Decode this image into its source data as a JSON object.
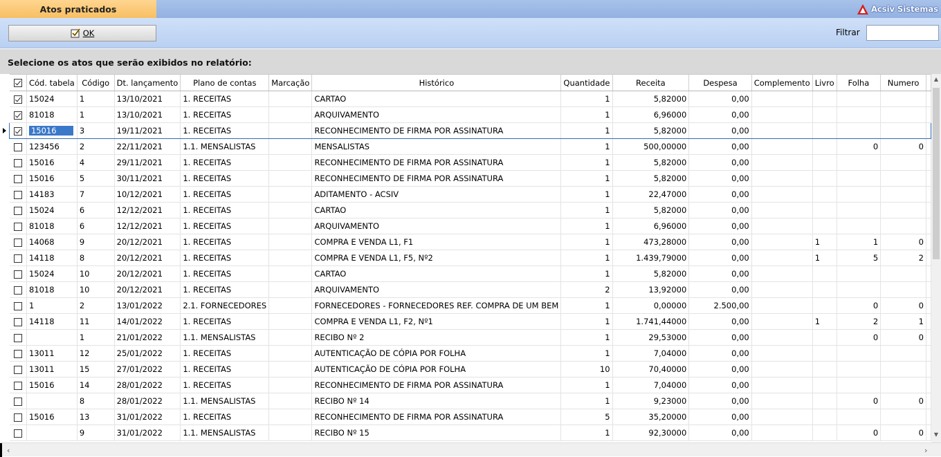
{
  "window": {
    "title": "Atos praticados",
    "brand": "Acsiv Sistemas"
  },
  "toolbar": {
    "ok_label": "OK",
    "filter_label": "Filtrar",
    "filter_value": ""
  },
  "instruction": "Selecione os atos que serão exibidos no relatório:",
  "grid": {
    "columns": [
      "Cód. tabela",
      "Código",
      "Dt. lançamento",
      "Plano de contas",
      "Marcação",
      "Histórico",
      "Quantidade",
      "Receita",
      "Despesa",
      "Complemento",
      "Livro",
      "Folha",
      "Numero"
    ],
    "current_row": 2,
    "rows": [
      {
        "checked": true,
        "cod_tabela": "15024",
        "codigo": "1",
        "dt": "13/10/2021",
        "plano": "1. RECEITAS",
        "marcacao": "",
        "historico": "CARTAO",
        "qtd": "1",
        "receita": "5,82000",
        "despesa": "0,00",
        "complemento": "",
        "livro": "",
        "folha": "",
        "numero": ""
      },
      {
        "checked": true,
        "cod_tabela": "81018",
        "codigo": "1",
        "dt": "13/10/2021",
        "plano": "1. RECEITAS",
        "marcacao": "",
        "historico": "ARQUIVAMENTO",
        "qtd": "1",
        "receita": "6,96000",
        "despesa": "0,00",
        "complemento": "",
        "livro": "",
        "folha": "",
        "numero": ""
      },
      {
        "checked": true,
        "cod_tabela": "15016",
        "codigo": "3",
        "dt": "19/11/2021",
        "plano": "1. RECEITAS",
        "marcacao": "",
        "historico": "RECONHECIMENTO DE FIRMA POR ASSINATURA",
        "qtd": "1",
        "receita": "5,82000",
        "despesa": "0,00",
        "complemento": "",
        "livro": "",
        "folha": "",
        "numero": ""
      },
      {
        "checked": false,
        "cod_tabela": "123456",
        "codigo": "2",
        "dt": "22/11/2021",
        "plano": "1.1. MENSALISTAS",
        "marcacao": "",
        "historico": "MENSALISTAS",
        "qtd": "1",
        "receita": "500,00000",
        "despesa": "0,00",
        "complemento": "",
        "livro": "",
        "folha": "0",
        "numero": "0"
      },
      {
        "checked": false,
        "cod_tabela": "15016",
        "codigo": "4",
        "dt": "29/11/2021",
        "plano": "1. RECEITAS",
        "marcacao": "",
        "historico": "RECONHECIMENTO DE FIRMA POR ASSINATURA",
        "qtd": "1",
        "receita": "5,82000",
        "despesa": "0,00",
        "complemento": "",
        "livro": "",
        "folha": "",
        "numero": ""
      },
      {
        "checked": false,
        "cod_tabela": "15016",
        "codigo": "5",
        "dt": "30/11/2021",
        "plano": "1. RECEITAS",
        "marcacao": "",
        "historico": "RECONHECIMENTO DE FIRMA POR ASSINATURA",
        "qtd": "1",
        "receita": "5,82000",
        "despesa": "0,00",
        "complemento": "",
        "livro": "",
        "folha": "",
        "numero": ""
      },
      {
        "checked": false,
        "cod_tabela": "14183",
        "codigo": "7",
        "dt": "10/12/2021",
        "plano": "1. RECEITAS",
        "marcacao": "",
        "historico": "ADITAMENTO - ACSIV",
        "qtd": "1",
        "receita": "22,47000",
        "despesa": "0,00",
        "complemento": "",
        "livro": "",
        "folha": "",
        "numero": ""
      },
      {
        "checked": false,
        "cod_tabela": "15024",
        "codigo": "6",
        "dt": "12/12/2021",
        "plano": "1. RECEITAS",
        "marcacao": "",
        "historico": "CARTAO",
        "qtd": "1",
        "receita": "5,82000",
        "despesa": "0,00",
        "complemento": "",
        "livro": "",
        "folha": "",
        "numero": ""
      },
      {
        "checked": false,
        "cod_tabela": "81018",
        "codigo": "6",
        "dt": "12/12/2021",
        "plano": "1. RECEITAS",
        "marcacao": "",
        "historico": "ARQUIVAMENTO",
        "qtd": "1",
        "receita": "6,96000",
        "despesa": "0,00",
        "complemento": "",
        "livro": "",
        "folha": "",
        "numero": ""
      },
      {
        "checked": false,
        "cod_tabela": "14068",
        "codigo": "9",
        "dt": "20/12/2021",
        "plano": "1. RECEITAS",
        "marcacao": "",
        "historico": "COMPRA E VENDA L1, F1",
        "qtd": "1",
        "receita": "473,28000",
        "despesa": "0,00",
        "complemento": "",
        "livro": "1",
        "folha": "1",
        "numero": "0"
      },
      {
        "checked": false,
        "cod_tabela": "14118",
        "codigo": "8",
        "dt": "20/12/2021",
        "plano": "1. RECEITAS",
        "marcacao": "",
        "historico": "COMPRA E VENDA L1, F5, Nº2",
        "qtd": "1",
        "receita": "1.439,79000",
        "despesa": "0,00",
        "complemento": "",
        "livro": "1",
        "folha": "5",
        "numero": "2"
      },
      {
        "checked": false,
        "cod_tabela": "15024",
        "codigo": "10",
        "dt": "20/12/2021",
        "plano": "1. RECEITAS",
        "marcacao": "",
        "historico": "CARTAO",
        "qtd": "1",
        "receita": "5,82000",
        "despesa": "0,00",
        "complemento": "",
        "livro": "",
        "folha": "",
        "numero": ""
      },
      {
        "checked": false,
        "cod_tabela": "81018",
        "codigo": "10",
        "dt": "20/12/2021",
        "plano": "1. RECEITAS",
        "marcacao": "",
        "historico": "ARQUIVAMENTO",
        "qtd": "2",
        "receita": "13,92000",
        "despesa": "0,00",
        "complemento": "",
        "livro": "",
        "folha": "",
        "numero": ""
      },
      {
        "checked": false,
        "cod_tabela": "1",
        "codigo": "2",
        "dt": "13/01/2022",
        "plano": "2.1. FORNECEDORES",
        "marcacao": "",
        "historico": "FORNECEDORES - FORNECEDORES REF. COMPRA DE UM BEM",
        "qtd": "1",
        "receita": "0,00000",
        "despesa": "2.500,00",
        "complemento": "",
        "livro": "",
        "folha": "0",
        "numero": "0"
      },
      {
        "checked": false,
        "cod_tabela": "14118",
        "codigo": "11",
        "dt": "14/01/2022",
        "plano": "1. RECEITAS",
        "marcacao": "",
        "historico": "COMPRA E VENDA L1, F2, Nº1",
        "qtd": "1",
        "receita": "1.741,44000",
        "despesa": "0,00",
        "complemento": "",
        "livro": "1",
        "folha": "2",
        "numero": "1"
      },
      {
        "checked": false,
        "cod_tabela": "",
        "codigo": "1",
        "dt": "21/01/2022",
        "plano": "1.1. MENSALISTAS",
        "marcacao": "",
        "historico": "RECIBO Nº 2",
        "qtd": "1",
        "receita": "29,53000",
        "despesa": "0,00",
        "complemento": "",
        "livro": "",
        "folha": "0",
        "numero": "0"
      },
      {
        "checked": false,
        "cod_tabela": "13011",
        "codigo": "12",
        "dt": "25/01/2022",
        "plano": "1. RECEITAS",
        "marcacao": "",
        "historico": "AUTENTICAÇÃO DE CÓPIA POR FOLHA",
        "qtd": "1",
        "receita": "7,04000",
        "despesa": "0,00",
        "complemento": "",
        "livro": "",
        "folha": "",
        "numero": ""
      },
      {
        "checked": false,
        "cod_tabela": "13011",
        "codigo": "15",
        "dt": "27/01/2022",
        "plano": "1. RECEITAS",
        "marcacao": "",
        "historico": "AUTENTICAÇÃO DE CÓPIA POR FOLHA",
        "qtd": "10",
        "receita": "70,40000",
        "despesa": "0,00",
        "complemento": "",
        "livro": "",
        "folha": "",
        "numero": ""
      },
      {
        "checked": false,
        "cod_tabela": "15016",
        "codigo": "14",
        "dt": "28/01/2022",
        "plano": "1. RECEITAS",
        "marcacao": "",
        "historico": "RECONHECIMENTO DE FIRMA POR ASSINATURA",
        "qtd": "1",
        "receita": "7,04000",
        "despesa": "0,00",
        "complemento": "",
        "livro": "",
        "folha": "",
        "numero": ""
      },
      {
        "checked": false,
        "cod_tabela": "",
        "codigo": "8",
        "dt": "28/01/2022",
        "plano": "1.1. MENSALISTAS",
        "marcacao": "",
        "historico": "RECIBO Nº 14",
        "qtd": "1",
        "receita": "9,23000",
        "despesa": "0,00",
        "complemento": "",
        "livro": "",
        "folha": "0",
        "numero": "0"
      },
      {
        "checked": false,
        "cod_tabela": "15016",
        "codigo": "13",
        "dt": "31/01/2022",
        "plano": "1. RECEITAS",
        "marcacao": "",
        "historico": "RECONHECIMENTO DE FIRMA POR ASSINATURA",
        "qtd": "5",
        "receita": "35,20000",
        "despesa": "0,00",
        "complemento": "",
        "livro": "",
        "folha": "",
        "numero": ""
      },
      {
        "checked": false,
        "cod_tabela": "",
        "codigo": "9",
        "dt": "31/01/2022",
        "plano": "1.1. MENSALISTAS",
        "marcacao": "",
        "historico": "RECIBO Nº 15",
        "qtd": "1",
        "receita": "92,30000",
        "despesa": "0,00",
        "complemento": "",
        "livro": "",
        "folha": "0",
        "numero": "0"
      }
    ]
  },
  "colors": {
    "title_tab": "#f7bf62",
    "titlebar": "#93b1e1",
    "toolbar": "#c4d8f5",
    "selection": "#3a78c9"
  },
  "icons": {
    "brand": "triangle-logo-icon",
    "ok": "checkbox-checked-icon",
    "row_indicator": "row-pointer-icon"
  }
}
